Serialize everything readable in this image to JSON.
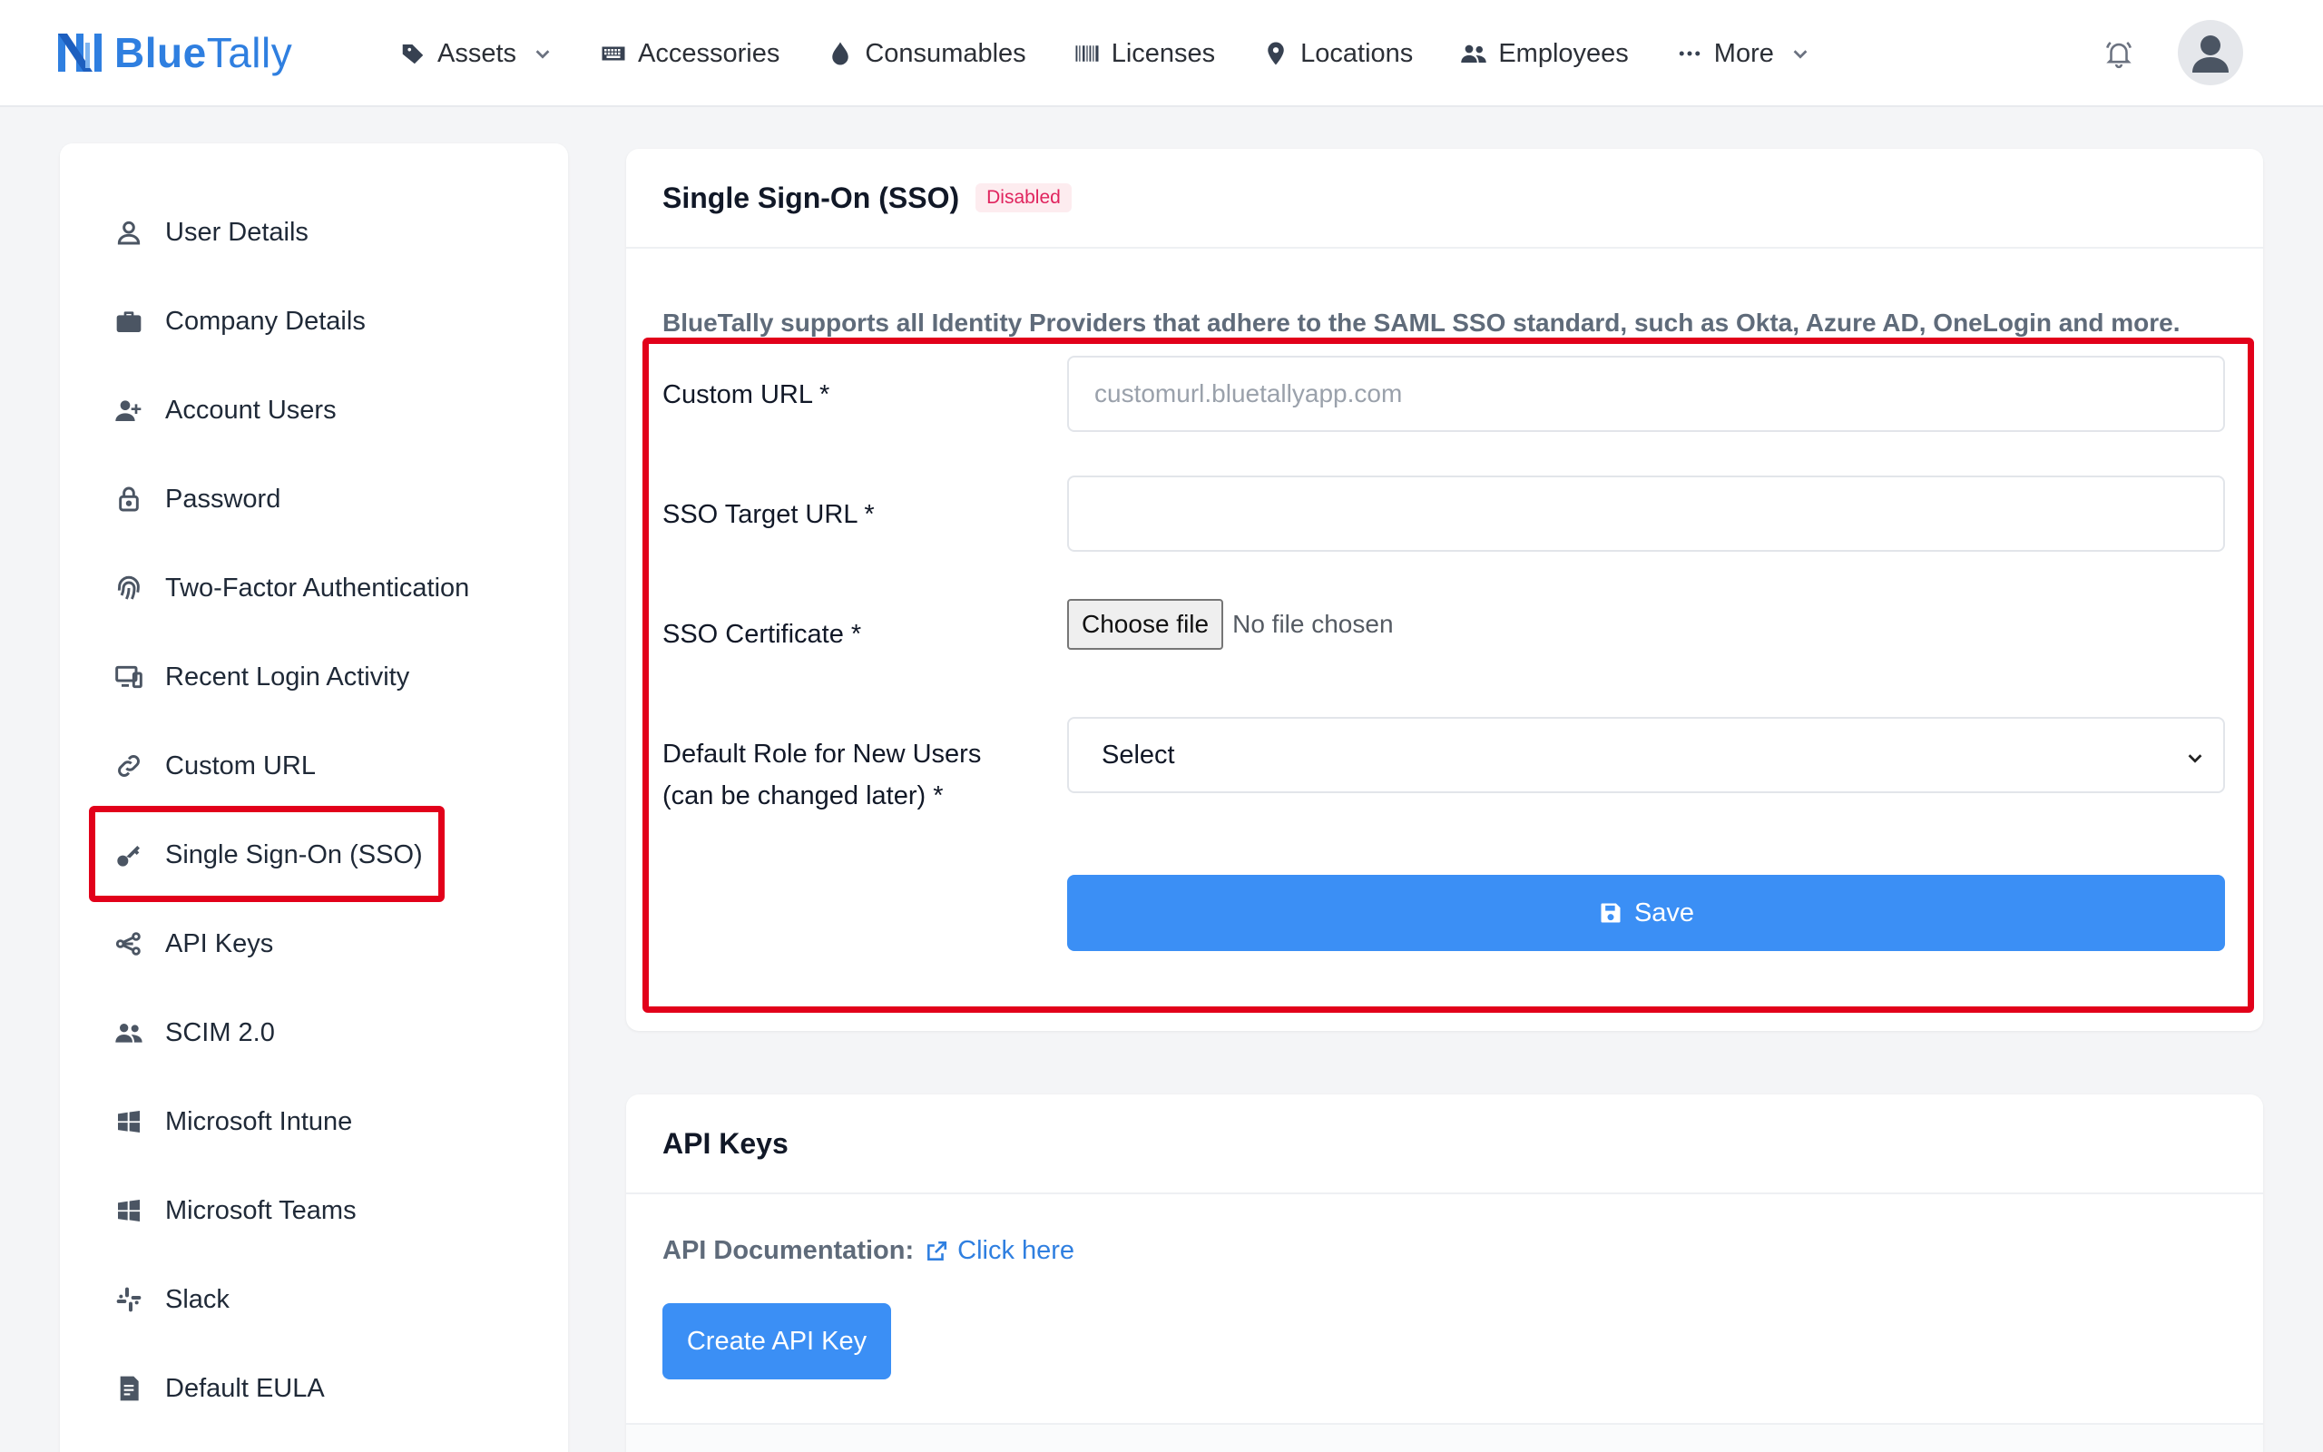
{
  "brand": {
    "name_part1": "Blue",
    "name_part2": "Tally"
  },
  "nav": {
    "items": [
      {
        "label": "Assets",
        "icon": "tag-icon",
        "dropdown": true
      },
      {
        "label": "Accessories",
        "icon": "keyboard-icon",
        "dropdown": false
      },
      {
        "label": "Consumables",
        "icon": "drop-icon",
        "dropdown": false
      },
      {
        "label": "Licenses",
        "icon": "barcode-icon",
        "dropdown": false
      },
      {
        "label": "Locations",
        "icon": "map-pin-icon",
        "dropdown": false
      },
      {
        "label": "Employees",
        "icon": "users-icon",
        "dropdown": false
      },
      {
        "label": "More",
        "icon": "ellipsis-icon",
        "dropdown": true
      }
    ]
  },
  "sidebar": {
    "items": [
      {
        "label": "User Details"
      },
      {
        "label": "Company Details"
      },
      {
        "label": "Account Users"
      },
      {
        "label": "Password"
      },
      {
        "label": "Two-Factor Authentication"
      },
      {
        "label": "Recent Login Activity"
      },
      {
        "label": "Custom URL"
      },
      {
        "label": "Single Sign-On (SSO)"
      },
      {
        "label": "API Keys"
      },
      {
        "label": "SCIM 2.0"
      },
      {
        "label": "Microsoft Intune"
      },
      {
        "label": "Microsoft Teams"
      },
      {
        "label": "Slack"
      },
      {
        "label": "Default EULA"
      }
    ]
  },
  "sso": {
    "title": "Single Sign-On (SSO)",
    "status": "Disabled",
    "intro": "BlueTally supports all Identity Providers that adhere to the SAML SSO standard, such as Okta, Azure AD, OneLogin and more.",
    "custom_url_label": "Custom URL *",
    "custom_url_placeholder": "customurl.bluetallyapp.com",
    "target_url_label": "SSO Target URL *",
    "target_url_value": "",
    "certificate_label": "SSO Certificate *",
    "file_button": "Choose file",
    "file_status": "No file chosen",
    "role_label_line1": "Default Role for New Users",
    "role_label_line2": "(can be changed later) *",
    "role_selected": "Select",
    "save_label": "Save"
  },
  "api": {
    "title": "API Keys",
    "doc_label": "API Documentation:",
    "doc_link": "Click here",
    "create_label": "Create API Key"
  },
  "colors": {
    "accent": "#3b8ff5",
    "highlight": "#e2001a",
    "badge": "#e0245e"
  }
}
